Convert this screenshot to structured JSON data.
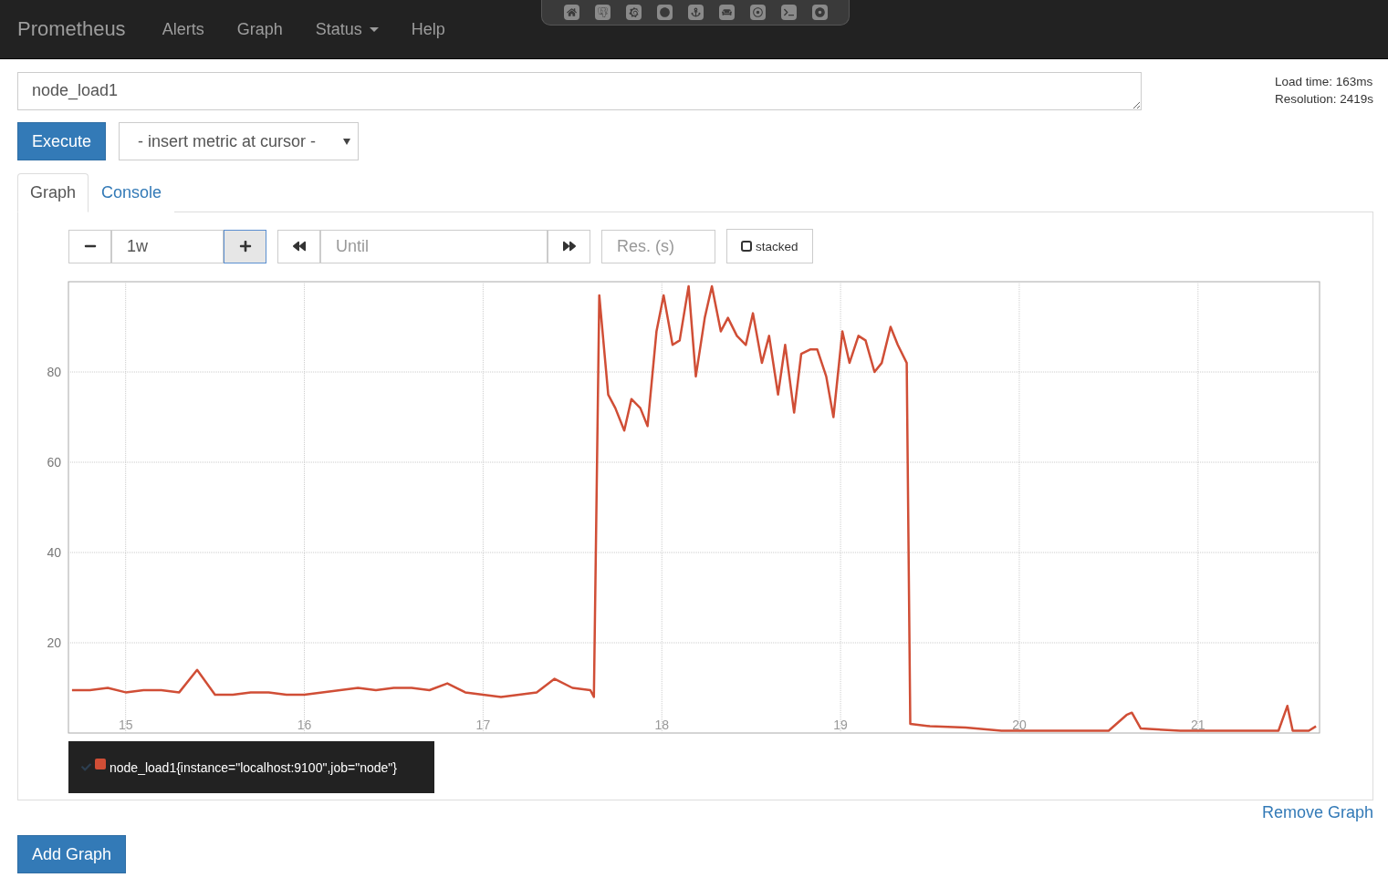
{
  "navbar": {
    "brand": "Prometheus",
    "links": [
      {
        "label": "Alerts",
        "kind": "link"
      },
      {
        "label": "Graph",
        "kind": "link"
      },
      {
        "label": "Status",
        "kind": "dropdown"
      },
      {
        "label": "Help",
        "kind": "link"
      }
    ]
  },
  "expression": {
    "value": "node_load1",
    "execute": "Execute",
    "metric_select": "- insert metric at cursor -"
  },
  "stats": {
    "load_time": "Load time: 163ms",
    "resolution": "Resolution: 2419s"
  },
  "tabs": [
    {
      "label": "Graph",
      "selected": true
    },
    {
      "label": "Console",
      "selected": false
    }
  ],
  "controls": {
    "range": "1w",
    "until_placeholder": "Until",
    "res_placeholder": "Res. (s)",
    "stacked": {
      "label": "stacked",
      "checked": false
    }
  },
  "chart_data": {
    "type": "line",
    "grid": true,
    "xlim": [
      14.68,
      21.68
    ],
    "ylim": [
      0,
      100
    ],
    "xticks": [
      15,
      16,
      17,
      18,
      19,
      20,
      21
    ],
    "yticks": [
      20,
      40,
      60,
      80
    ],
    "x": [
      14.7,
      14.8,
      14.9,
      15.0,
      15.1,
      15.2,
      15.3,
      15.4,
      15.5,
      15.6,
      15.7,
      15.8,
      15.9,
      16.0,
      16.1,
      16.2,
      16.3,
      16.4,
      16.5,
      16.6,
      16.7,
      16.8,
      16.9,
      17.0,
      17.1,
      17.2,
      17.3,
      17.4,
      17.5,
      17.6,
      17.62,
      17.65,
      17.7,
      17.74,
      17.79,
      17.83,
      17.88,
      17.92,
      17.97,
      18.01,
      18.06,
      18.1,
      18.15,
      18.19,
      18.24,
      18.28,
      18.33,
      18.37,
      18.42,
      18.47,
      18.51,
      18.56,
      18.6,
      18.65,
      18.69,
      18.74,
      18.78,
      18.83,
      18.87,
      18.92,
      18.96,
      19.01,
      19.05,
      19.1,
      19.14,
      19.19,
      19.23,
      19.28,
      19.32,
      19.37,
      19.39,
      19.5,
      19.7,
      19.9,
      20.2,
      20.5,
      20.6,
      20.63,
      20.68,
      20.9,
      21.2,
      21.45,
      21.5,
      21.53,
      21.62,
      21.66
    ],
    "series": [
      {
        "name": "node_load1{instance=\"localhost:9100\",job=\"node\"}",
        "color": "#d04e36",
        "values": [
          9.5,
          9.5,
          10,
          9,
          9.5,
          9.5,
          9,
          14,
          8.5,
          8.5,
          9,
          9,
          8.5,
          8.5,
          9,
          9.5,
          10,
          9.5,
          10,
          10,
          9.5,
          11,
          9,
          8.5,
          8,
          8.5,
          9,
          12,
          10,
          9.5,
          8,
          97,
          75,
          72,
          67,
          74,
          72,
          68,
          89,
          97,
          86,
          87,
          99,
          79,
          92,
          99,
          89,
          92,
          88,
          86,
          93,
          82,
          88,
          75,
          86,
          71,
          84,
          85,
          85,
          79,
          70,
          89,
          82,
          88,
          87,
          80,
          82,
          90,
          86,
          82,
          2,
          1.5,
          1.2,
          0.5,
          0.5,
          0.5,
          4,
          4.5,
          1,
          0.5,
          0.5,
          0.5,
          6,
          0.5,
          0.5,
          1.5
        ]
      }
    ]
  },
  "remove_graph": "Remove Graph",
  "add_graph": "Add Graph"
}
